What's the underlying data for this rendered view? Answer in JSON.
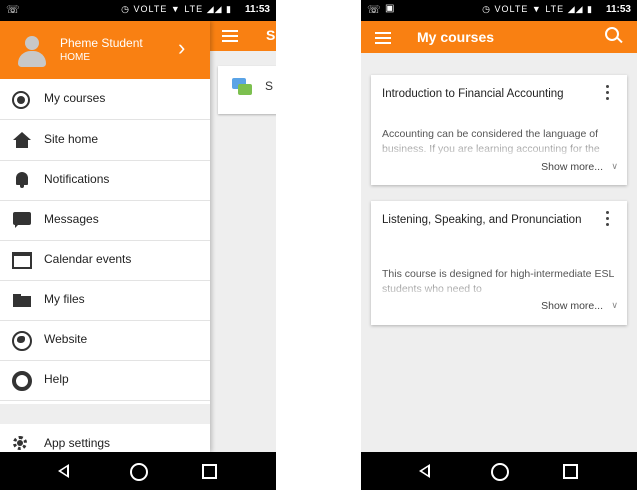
{
  "status_bar": {
    "time": "11:53",
    "network": "LTE",
    "volte": "VOLTE"
  },
  "left_screen": {
    "background_title": "S",
    "background_card_text": "S",
    "drawer": {
      "user_name": "Pheme Student",
      "user_subtitle": "HOME",
      "chevron": "›",
      "items": [
        {
          "label": "My courses",
          "icon": "radio-button-icon"
        },
        {
          "label": "Site home",
          "icon": "home-icon"
        },
        {
          "label": "Notifications",
          "icon": "bell-icon"
        },
        {
          "label": "Messages",
          "icon": "message-icon"
        },
        {
          "label": "Calendar events",
          "icon": "calendar-icon"
        },
        {
          "label": "My files",
          "icon": "folder-icon"
        },
        {
          "label": "Website",
          "icon": "globe-icon"
        },
        {
          "label": "Help",
          "icon": "help-icon"
        }
      ],
      "settings_label": "App settings"
    }
  },
  "right_screen": {
    "title": "My courses",
    "courses": [
      {
        "title": "Introduction to Financial Accounting",
        "summary": "Accounting can be considered the language of business. If you are learning accounting for the",
        "show_more": "Show more..."
      },
      {
        "title": "Listening, Speaking, and Pronunciation",
        "summary": "This course is designed for high-intermediate ESL students who need to",
        "show_more": "Show more..."
      }
    ]
  },
  "nav_bar": {
    "back_icon": "back-icon",
    "home_icon": "home-circle-icon",
    "recents_icon": "recents-icon"
  },
  "colors": {
    "accent": "#f98012",
    "background": "#eeeeee"
  }
}
